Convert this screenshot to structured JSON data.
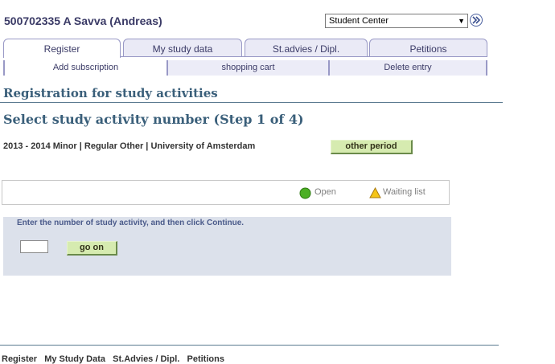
{
  "header": {
    "user_name": "500702335 A Savva (Andreas)",
    "center_select": {
      "selected": "Student Center"
    }
  },
  "tabs": [
    {
      "label": "Register"
    },
    {
      "label": "My study data"
    },
    {
      "label": "St.advies / Dipl."
    },
    {
      "label": "Petitions"
    }
  ],
  "subtabs": [
    {
      "label": "Add subscription"
    },
    {
      "label": "shopping cart"
    },
    {
      "label": "Delete entry"
    }
  ],
  "page": {
    "heading": "Registration for study activities",
    "step_heading": "Select study activity number (Step 1 of 4)",
    "period_text": "2013 - 2014 Minor | Regular Other | University of Amsterdam",
    "other_period_label": "other period"
  },
  "legend": {
    "open_label": "Open",
    "waiting_label": "Waiting list"
  },
  "entry": {
    "instructions": "Enter the number of study activity, and then click Continue.",
    "input_value": "",
    "go_on_label": "go on"
  },
  "footer": {
    "links": [
      "Register",
      "My Study Data",
      "St.Advies / Dipl.",
      "Petitions"
    ]
  },
  "colors": {
    "tab_border": "#9999c6",
    "heading": "#3a5f7a",
    "button_green": "#d6ebb0",
    "panel": "#dce1eb",
    "open_status": "#4caf25",
    "waiting_status": "#f5c518"
  }
}
